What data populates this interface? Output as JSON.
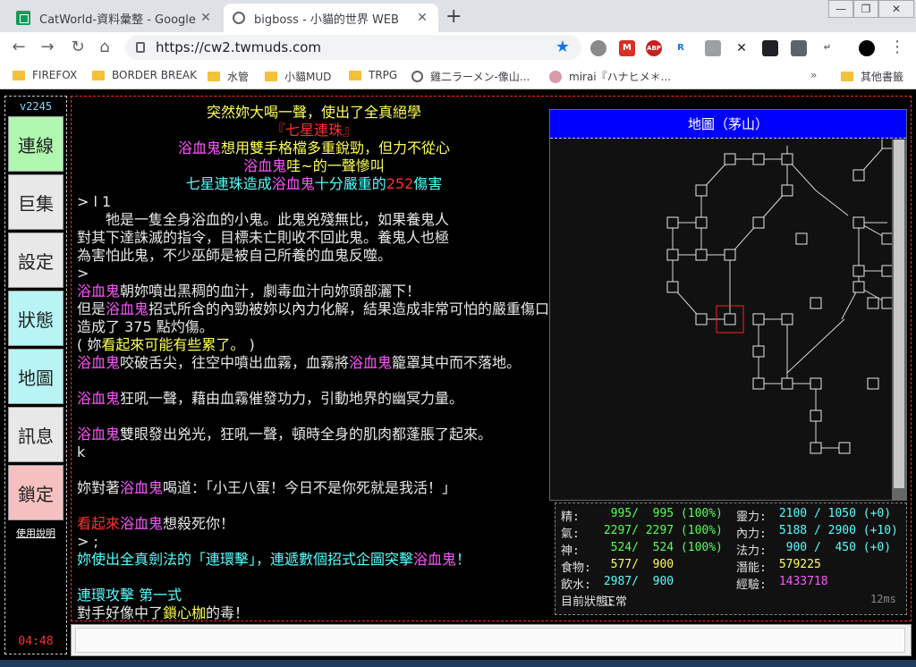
{
  "browser": {
    "tabs": [
      {
        "title": "CatWorld-資料彙整 - Google 試",
        "icon": "sheets-icon"
      },
      {
        "title": "bigboss - 小貓的世界 WEB",
        "icon": "globe-icon"
      }
    ],
    "url": "https://cw2.twmuds.com",
    "bookmarks": [
      "FIREFOX",
      "BORDER BREAK",
      "水管",
      "小貓MUD",
      "TRPG",
      "雞二ラーメン-像山...",
      "mirai『ハナヒメ＊...",
      "其他書籤"
    ],
    "extensions": [
      "M",
      "ABP",
      "R"
    ]
  },
  "sidebar": {
    "version": "v2245",
    "buttons": [
      {
        "label": "連線",
        "color": "#b0f7b0"
      },
      {
        "label": "巨集",
        "color": "#e8e8e8"
      },
      {
        "label": "設定",
        "color": "#e8e8e8"
      },
      {
        "label": "狀態",
        "color": "#b8f4f4"
      },
      {
        "label": "地圖",
        "color": "#b8f4f4"
      },
      {
        "label": "訊息",
        "color": "#e8e8e8"
      },
      {
        "label": "鎖定",
        "color": "#f7c0c0"
      }
    ],
    "help": "使用說明",
    "clock": "04:48"
  },
  "log": [
    [
      {
        "t": "突然妳大喝一聲，使出了全真絕學",
        "c": "y"
      }
    ],
    [
      {
        "t": "『七星連珠』",
        "c": "r"
      }
    ],
    [
      {
        "t": "浴血鬼",
        "c": "m"
      },
      {
        "t": "想用雙手格檔多重銳勁，但力不從心",
        "c": "y"
      }
    ],
    [
      {
        "t": "浴血鬼",
        "c": "m"
      },
      {
        "t": "哇~的一聲慘叫",
        "c": "y"
      }
    ],
    [
      {
        "t": "七星連珠造成",
        "c": "cy"
      },
      {
        "t": "浴血鬼",
        "c": "m"
      },
      {
        "t": "十分嚴重的",
        "c": "cy"
      },
      {
        "t": "252",
        "c": "r"
      },
      {
        "t": "傷害",
        "c": "cy"
      }
    ],
    [
      {
        "t": "> l 1",
        "c": "w"
      }
    ],
    [
      {
        "t": "　　牠是一隻全身浴血的小鬼。此鬼兇殘無比，如果養鬼人",
        "c": "w"
      }
    ],
    [
      {
        "t": "對其下達誅滅的指令，目標未亡則收不回此鬼。養鬼人也極",
        "c": "w"
      }
    ],
    [
      {
        "t": "為害怕此鬼，不少巫師是被自己所養的血鬼反噬。",
        "c": "w"
      }
    ],
    [
      {
        "t": ">",
        "c": "w"
      }
    ],
    [
      {
        "t": "浴血鬼",
        "c": "m"
      },
      {
        "t": "朝妳噴出黑稠的血汁，劇毒血汁向妳頭部灑下！",
        "c": "w"
      }
    ],
    [
      {
        "t": "但是",
        "c": "w"
      },
      {
        "t": "浴血鬼",
        "c": "m"
      },
      {
        "t": "招式所含的內勁被妳以內力化解，結果造成非常可怕的嚴重傷口！",
        "c": "w"
      }
    ],
    [
      {
        "t": "造成了 375 點灼傷。",
        "c": "w"
      }
    ],
    [
      {
        "t": "( 妳",
        "c": "w"
      },
      {
        "t": "看起來可能有些累了。",
        "c": "y"
      },
      {
        "t": " )",
        "c": "w"
      }
    ],
    [
      {
        "t": "浴血鬼",
        "c": "m"
      },
      {
        "t": "咬破舌尖，往空中噴出血霧，血霧將",
        "c": "w"
      },
      {
        "t": "浴血鬼",
        "c": "m"
      },
      {
        "t": "籠罩其中而不落地。",
        "c": "w"
      }
    ],
    [
      {
        "t": "",
        "c": "w"
      }
    ],
    [
      {
        "t": "浴血鬼",
        "c": "m"
      },
      {
        "t": "狂吼一聲，藉由血霧催發功力，引動地界的幽冥力量。",
        "c": "w"
      }
    ],
    [
      {
        "t": "",
        "c": "w"
      }
    ],
    [
      {
        "t": "浴血鬼",
        "c": "m"
      },
      {
        "t": "雙眼發出兇光，狂吼一聲，頓時全身的肌肉都蓬脹了起來。",
        "c": "w"
      }
    ],
    [
      {
        "t": "k",
        "c": "w"
      }
    ],
    [
      {
        "t": "",
        "c": "w"
      }
    ],
    [
      {
        "t": "妳對著",
        "c": "w"
      },
      {
        "t": "浴血鬼",
        "c": "m"
      },
      {
        "t": "喝道：「小王八蛋！今日不是你死就是我活！」",
        "c": "w"
      }
    ],
    [
      {
        "t": "",
        "c": "w"
      }
    ],
    [
      {
        "t": "看起來",
        "c": "r"
      },
      {
        "t": "浴血鬼",
        "c": "m"
      },
      {
        "t": "想殺死你！",
        "c": "w"
      }
    ],
    [
      {
        "t": "> ;",
        "c": "w"
      }
    ],
    [
      {
        "t": "妳使出全真劍法的「連環擊」，連遞數個招式企圖突擊",
        "c": "cy"
      },
      {
        "t": "浴血鬼",
        "c": "m"
      },
      {
        "t": "！",
        "c": "cy"
      }
    ],
    [
      {
        "t": "",
        "c": "w"
      }
    ],
    [
      {
        "t": "連環攻擊 第一式",
        "c": "cy"
      }
    ],
    [
      {
        "t": "對手好像中了",
        "c": "w"
      },
      {
        "t": "鎖心枷",
        "c": "y"
      },
      {
        "t": "的毒！",
        "c": "w"
      }
    ]
  ],
  "map": {
    "title": "地圖（茅山）"
  },
  "stats": [
    {
      "l1": "精:",
      "v1": "  995/  995 (100%)",
      "c1": "#55ff55",
      "l2": "靈力:",
      "v2": " 2100 / 1050 (+0)",
      "c2": "#55ffff"
    },
    {
      "l1": "氣:",
      "v1": " 2297/ 2297 (100%)",
      "c1": "#55ff55",
      "l2": "內力:",
      "v2": " 5188 / 2900 (+10)",
      "c2": "#55ffff"
    },
    {
      "l1": "神:",
      "v1": "  524/  524 (100%)",
      "c1": "#55ff55",
      "l2": "法力:",
      "v2": "  900 /  450 (+0)",
      "c2": "#55ffff"
    },
    {
      "l1": "食物:",
      "v1": "  577/  900",
      "c1": "#ffff55",
      "l2": "潛能:",
      "v2": " 579225",
      "c2": "#ffff55"
    },
    {
      "l1": "飲水:",
      "v1": " 2987/  900",
      "c1": "#55ffff",
      "l2": "經驗:",
      "v2": " 1433718",
      "c2": "#ff55ff"
    },
    {
      "l1": "目前狀態:",
      "v1": " 正常",
      "c1": "#e0e0e0",
      "l2": "",
      "v2": "",
      "c2": "#e0e0e0"
    }
  ],
  "latency": "12ms"
}
